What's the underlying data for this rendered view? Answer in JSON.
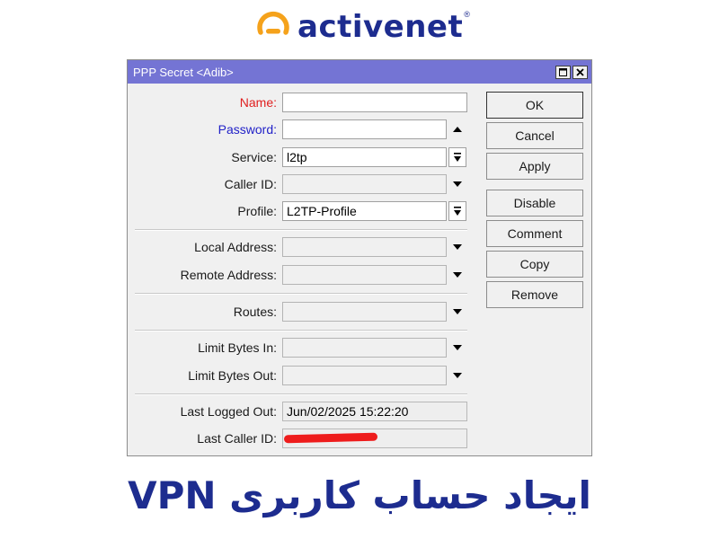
{
  "brand": {
    "name": "activenet",
    "registered": "®",
    "icon": "activenet-logo-icon",
    "color_orange": "#f5a21b",
    "color_blue": "#1d2c8f"
  },
  "window": {
    "title": "PPP Secret <Adib>",
    "titlebar_color": "#7474d4",
    "controls": [
      "maximize-icon",
      "close-icon"
    ]
  },
  "form": {
    "name": {
      "label": "Name:",
      "value": ""
    },
    "password": {
      "label": "Password:",
      "value": ""
    },
    "service": {
      "label": "Service:",
      "value": "l2tp"
    },
    "caller_id": {
      "label": "Caller ID:",
      "value": ""
    },
    "profile": {
      "label": "Profile:",
      "value": "L2TP-Profile"
    },
    "local_address": {
      "label": "Local Address:",
      "value": ""
    },
    "remote_address": {
      "label": "Remote Address:",
      "value": ""
    },
    "routes": {
      "label": "Routes:",
      "value": ""
    },
    "limit_bytes_in": {
      "label": "Limit Bytes In:",
      "value": ""
    },
    "limit_bytes_out": {
      "label": "Limit Bytes Out:",
      "value": ""
    },
    "last_logged_out": {
      "label": "Last Logged Out:",
      "value": "Jun/02/2025 15:22:20"
    },
    "last_caller_id": {
      "label": "Last Caller ID:",
      "value": ""
    }
  },
  "buttons": {
    "ok": "OK",
    "cancel": "Cancel",
    "apply": "Apply",
    "disable": "Disable",
    "comment": "Comment",
    "copy": "Copy",
    "remove": "Remove"
  },
  "caption": "ایجاد حساب کاربری VPN"
}
